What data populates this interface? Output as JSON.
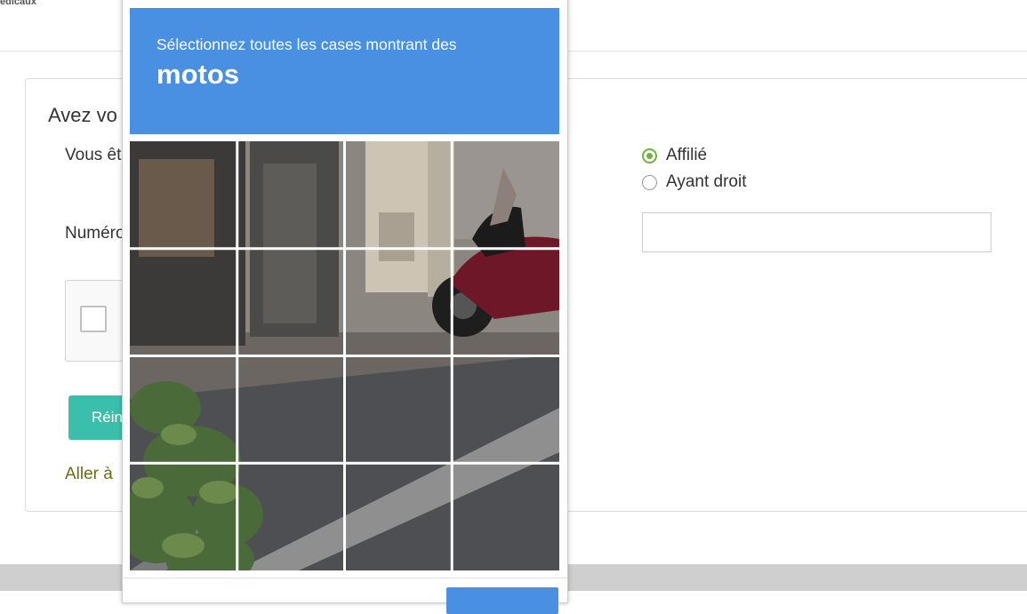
{
  "header": {
    "logo_text": "édicaux"
  },
  "form": {
    "title": "Avez vo",
    "status_label": "Vous êt",
    "number_label": "Numéro",
    "radio_options": [
      {
        "label": "Affilié",
        "checked": true
      },
      {
        "label": "Ayant droit",
        "checked": false
      }
    ],
    "number_input_value": "",
    "reset_label": "Réin",
    "goto_label": "Aller à"
  },
  "captcha": {
    "instruction": "Sélectionnez toutes les cases montrant des",
    "target": "motos",
    "grid_rows": 4,
    "grid_cols": 4,
    "accent_color": "#4a90e2"
  },
  "colors": {
    "reset_button": "#3bbfad",
    "radio_selected": "#6db33f",
    "link": "#6b6b17"
  }
}
